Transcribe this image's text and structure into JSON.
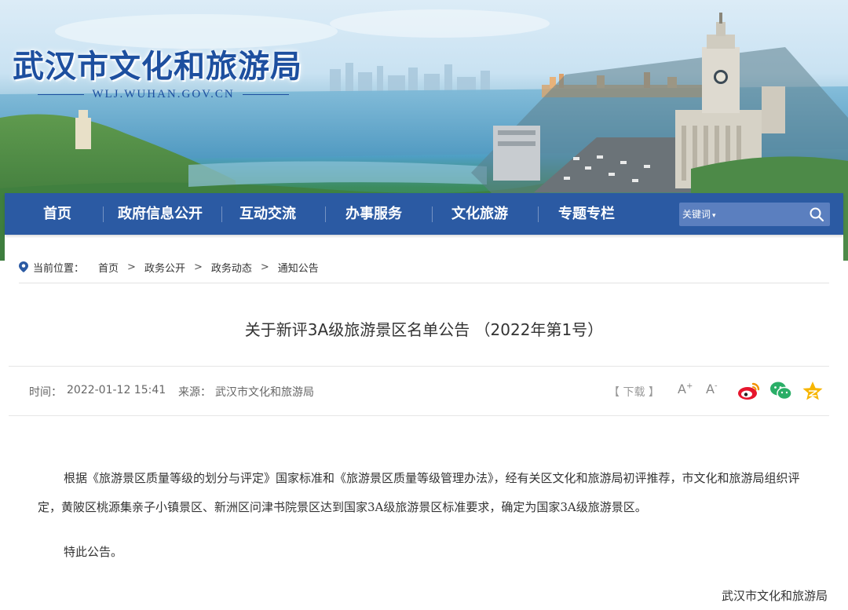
{
  "site": {
    "title": "武汉市文化和旅游局",
    "domain": "WLJ.WUHAN.GOV.CN"
  },
  "nav": {
    "items": [
      {
        "label": "首页"
      },
      {
        "label": "政府信息公开"
      },
      {
        "label": "互动交流"
      },
      {
        "label": "办事服务"
      },
      {
        "label": "文化旅游"
      },
      {
        "label": "专题专栏"
      }
    ],
    "search": {
      "type_label": "关键词",
      "placeholder": "",
      "icon": "search-icon"
    }
  },
  "breadcrumb": {
    "label": "当前位置：",
    "icon": "location-pin-icon",
    "items": [
      "首页",
      "政务公开",
      "政务动态",
      "通知公告"
    ],
    "separator": ">"
  },
  "article": {
    "title": "关于新评3A级旅游景区名单公告 （2022年第1号）",
    "time_label": "时间：",
    "time": "2022-01-12 15:41",
    "source_label": "来源：",
    "source": "武汉市文化和旅游局",
    "download_label": "【 下载 】",
    "font_increase": "A",
    "font_decrease": "A",
    "share_icons": [
      "weibo-icon",
      "wechat-icon",
      "qzone-icon"
    ],
    "paragraphs": [
      "根据《旅游景区质量等级的划分与评定》国家标准和《旅游景区质量等级管理办法》，经有关区文化和旅游局初评推荐，市文化和旅游局组织评定，黄陂区桃源集亲子小镇景区、新洲区问津书院景区达到国家3A级旅游景区标准要求，确定为国家3A级旅游景区。",
      "特此公告。"
    ],
    "signature": "武汉市文化和旅游局"
  },
  "colors": {
    "nav_bg": "#2b5aa3",
    "title_blue": "#1d4f9f",
    "weibo": "#e6162d",
    "wechat": "#2aae67",
    "qzone": "#f7b500"
  }
}
